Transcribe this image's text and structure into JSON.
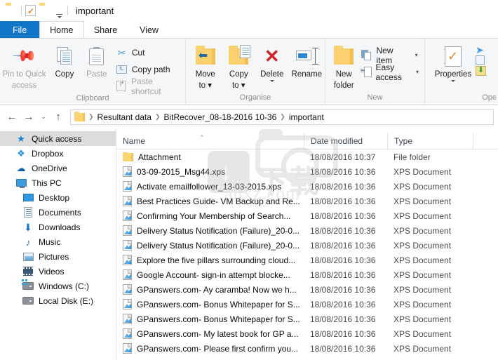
{
  "window": {
    "title": "important"
  },
  "quick_access_toolbar": {
    "items": [
      {
        "name": "folder-properties-icon",
        "label": ""
      },
      {
        "name": "properties-check-icon",
        "label": ""
      },
      {
        "name": "new-folder-icon",
        "label": ""
      },
      {
        "name": "customize-qat-caret",
        "label": ""
      }
    ]
  },
  "tabs": [
    {
      "id": "file",
      "label": "File",
      "active": false
    },
    {
      "id": "home",
      "label": "Home",
      "active": true
    },
    {
      "id": "share",
      "label": "Share",
      "active": false
    },
    {
      "id": "view",
      "label": "View",
      "active": false
    }
  ],
  "ribbon": {
    "groups": [
      {
        "id": "clipboard",
        "label": "Clipboard",
        "big_buttons": [
          {
            "id": "pin-to-quick-access",
            "line1": "Pin to Quick",
            "line2": "access",
            "dimmed": true
          },
          {
            "id": "copy",
            "line1": "Copy",
            "line2": "",
            "dimmed": false
          },
          {
            "id": "paste",
            "line1": "Paste",
            "line2": "",
            "dimmed": true
          }
        ],
        "small_buttons": [
          {
            "id": "cut",
            "label": "Cut",
            "dimmed": false
          },
          {
            "id": "copy-path",
            "label": "Copy path",
            "dimmed": false
          },
          {
            "id": "paste-shortcut",
            "label": "Paste shortcut",
            "dimmed": true
          }
        ]
      },
      {
        "id": "organise",
        "label": "Organise",
        "big_buttons": [
          {
            "id": "move-to",
            "line1": "Move",
            "line2": "to",
            "caret": true
          },
          {
            "id": "copy-to",
            "line1": "Copy",
            "line2": "to",
            "caret": true
          },
          {
            "id": "delete",
            "line1": "Delete",
            "line2": "",
            "caret": true
          },
          {
            "id": "rename",
            "line1": "Rename",
            "line2": "",
            "caret": false
          }
        ]
      },
      {
        "id": "new",
        "label": "New",
        "big_buttons": [
          {
            "id": "new-folder",
            "line1": "New",
            "line2": "folder",
            "caret": false
          }
        ],
        "small_buttons": [
          {
            "id": "new-item",
            "label": "New item",
            "caret": true
          },
          {
            "id": "easy-access",
            "label": "Easy access",
            "caret": true
          }
        ]
      },
      {
        "id": "open",
        "label": "Ope",
        "big_buttons": [
          {
            "id": "properties",
            "line1": "Properties",
            "line2": "",
            "caret": true
          }
        ]
      }
    ]
  },
  "address_bar": {
    "back_label": "←",
    "forward_label": "→",
    "recent_label": "⌄",
    "up_label": "↑",
    "breadcrumbs": [
      "Resultant data",
      "BitRecover_08-18-2016 10-36",
      "important"
    ]
  },
  "nav_pane": {
    "items": [
      {
        "id": "quick-access",
        "label": "Quick access",
        "icon": "star-icon",
        "indent": 0,
        "selected": true
      },
      {
        "id": "dropbox",
        "label": "Dropbox",
        "icon": "dropbox-icon",
        "indent": 0,
        "selected": false
      },
      {
        "id": "onedrive",
        "label": "OneDrive",
        "icon": "cloud-icon",
        "indent": 0,
        "selected": false
      },
      {
        "id": "this-pc",
        "label": "This PC",
        "icon": "monitor-icon",
        "indent": 0,
        "selected": false
      },
      {
        "id": "desktop",
        "label": "Desktop",
        "icon": "desktop-icon",
        "indent": 1,
        "selected": false
      },
      {
        "id": "documents",
        "label": "Documents",
        "icon": "document-icon",
        "indent": 1,
        "selected": false
      },
      {
        "id": "downloads",
        "label": "Downloads",
        "icon": "download-icon",
        "indent": 1,
        "selected": false
      },
      {
        "id": "music",
        "label": "Music",
        "icon": "music-icon",
        "indent": 1,
        "selected": false
      },
      {
        "id": "pictures",
        "label": "Pictures",
        "icon": "picture-icon",
        "indent": 1,
        "selected": false
      },
      {
        "id": "videos",
        "label": "Videos",
        "icon": "video-icon",
        "indent": 1,
        "selected": false
      },
      {
        "id": "windows-c",
        "label": "Windows (C:)",
        "icon": "drive-windows-icon",
        "indent": 1,
        "selected": false
      },
      {
        "id": "local-disk-e",
        "label": "Local Disk (E:)",
        "icon": "drive-icon",
        "indent": 1,
        "selected": false
      }
    ]
  },
  "file_list": {
    "columns": [
      {
        "id": "name",
        "label": "Name",
        "sorted": "asc"
      },
      {
        "id": "date",
        "label": "Date modified"
      },
      {
        "id": "type",
        "label": "Type"
      }
    ],
    "rows": [
      {
        "name": "Attachment",
        "date": "18/08/2016 10:37",
        "type": "File folder",
        "icon": "folder-icon"
      },
      {
        "name": "03-09-2015_Msg44.xps",
        "date": "18/08/2016 10:36",
        "type": "XPS Document",
        "icon": "xps-icon"
      },
      {
        "name": "Activate emailfollower_13-03-2015.xps",
        "date": "18/08/2016 10:36",
        "type": "XPS Document",
        "icon": "xps-icon"
      },
      {
        "name": "Best Practices Guide- VM Backup and Re...",
        "date": "18/08/2016 10:36",
        "type": "XPS Document",
        "icon": "xps-icon"
      },
      {
        "name": "Confirming Your Membership of Search...",
        "date": "18/08/2016 10:36",
        "type": "XPS Document",
        "icon": "xps-icon"
      },
      {
        "name": "Delivery Status Notification (Failure)_20-0...",
        "date": "18/08/2016 10:36",
        "type": "XPS Document",
        "icon": "xps-icon"
      },
      {
        "name": "Delivery Status Notification (Failure)_20-0...",
        "date": "18/08/2016 10:36",
        "type": "XPS Document",
        "icon": "xps-icon"
      },
      {
        "name": "Explore the five pillars surrounding cloud...",
        "date": "18/08/2016 10:36",
        "type": "XPS Document",
        "icon": "xps-icon"
      },
      {
        "name": "Google Account- sign-in attempt blocke...",
        "date": "18/08/2016 10:36",
        "type": "XPS Document",
        "icon": "xps-icon"
      },
      {
        "name": "GPanswers.com- Ay caramba! Now we h...",
        "date": "18/08/2016 10:36",
        "type": "XPS Document",
        "icon": "xps-icon"
      },
      {
        "name": "GPanswers.com- Bonus Whitepaper for S...",
        "date": "18/08/2016 10:36",
        "type": "XPS Document",
        "icon": "xps-icon"
      },
      {
        "name": "GPanswers.com- Bonus Whitepaper for S...",
        "date": "18/08/2016 10:36",
        "type": "XPS Document",
        "icon": "xps-icon"
      },
      {
        "name": "GPanswers.com- My latest book for GP a...",
        "date": "18/08/2016 10:36",
        "type": "XPS Document",
        "icon": "xps-icon"
      },
      {
        "name": "GPanswers.com- Please first confirm you...",
        "date": "18/08/2016 10:36",
        "type": "XPS Document",
        "icon": "xps-icon"
      }
    ]
  },
  "watermark": {
    "cn_text": "下载",
    "site_text": "anxz.com"
  },
  "colors": {
    "accent": "#1175c8",
    "ribbon_bg": "#f5f6f7",
    "selection": "#dcdcdc",
    "folder": "#fbd572"
  }
}
